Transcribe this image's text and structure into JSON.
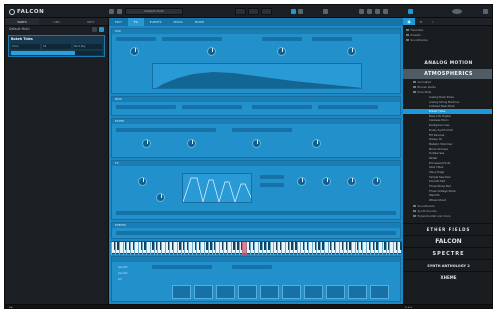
{
  "app": {
    "name": "FALCON"
  },
  "left_panel": {
    "tabs": [
      "PARTS",
      "LIBS",
      "INFO"
    ],
    "active_tab": 0,
    "part_label": "Default Multi",
    "program_name": "Bokeh Tides",
    "fields": [
      "Omni",
      "All",
      "Root Key"
    ],
    "meter_level": 0.7
  },
  "center": {
    "tabs": [
      "EDIT",
      "FX",
      "EVENTS",
      "MODS",
      "MIXER"
    ],
    "active_tab": 1,
    "sections": [
      "OSC",
      "MOD",
      "FILTER",
      "FX",
      "EVENTS"
    ],
    "arp_fields": [
      "Aa Oct",
      "Ca Oct",
      "All"
    ]
  },
  "right_panel": {
    "tree": [
      "Favorites",
      "Presets",
      "Soundbanks"
    ],
    "banner_title": "ANALOG MOTION",
    "category": "ATMOSPHERICS",
    "subtree": [
      "Animated",
      "Broken Radio",
      "Pure Pads"
    ],
    "presets": [
      "Analog Devil Pulse",
      "Analog String Machine",
      "Ambient Beachball",
      "Bokeh Tides",
      "Bass Info Digital",
      "Careless Moon",
      "Darkglow Lines",
      "Dusty Synth Choir",
      "FM Devices",
      "Glassy Air",
      "Metallic Shimmer",
      "Monochromes",
      "Outlaw Sea",
      "Padak",
      "Processed Hints",
      "Slow Tides",
      "Shiny Edge",
      "Simple Saw Pad",
      "Smooth Pad",
      "Three Noise Pad",
      "Three Voltage Stack",
      "Warmth",
      "Whale Shout"
    ],
    "selected_preset": 3,
    "subtree_after": [
      "Soundbanks",
      "Synth Sounds",
      "Experimental and more"
    ],
    "brands": [
      "ETHER FIELDS",
      "FALCON",
      "SPECTRE",
      "SYNTH ANTHOLOGY 2",
      "XHEME"
    ]
  },
  "colors": {
    "accent": "#1d98d8",
    "editor_bg": "#1e88c4",
    "panel_bg": "#1b1f23"
  }
}
